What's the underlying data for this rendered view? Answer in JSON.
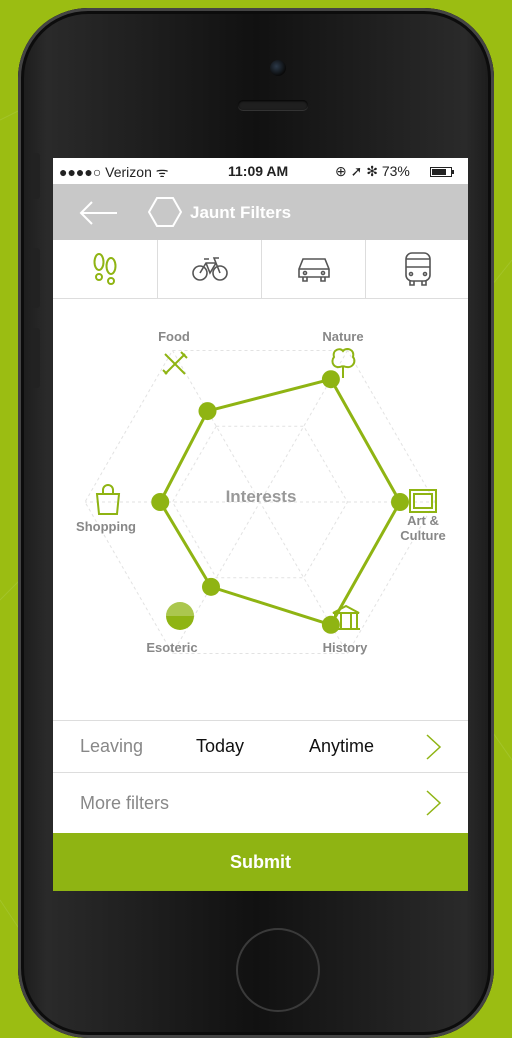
{
  "status": {
    "carrier": "●●●●○ Verizon ᯤ",
    "time": "11:09 AM",
    "right": "⊕ ➚ ✻ 73%"
  },
  "nav": {
    "title": "Jaunt Filters"
  },
  "modes": [
    "walk-icon",
    "bike-icon",
    "car-icon",
    "bus-icon"
  ],
  "radar": {
    "center_label": "Interests",
    "categories": [
      "Food",
      "Nature",
      "Art & Culture",
      "History",
      "Esoteric",
      "Shopping"
    ],
    "values": [
      0.6,
      0.81,
      0.8,
      0.81,
      0.56,
      0.57
    ]
  },
  "leaving": {
    "label": "Leaving",
    "day": "Today",
    "time": "Anytime"
  },
  "more": {
    "label": "More filters"
  },
  "submit": {
    "label": "Submit"
  },
  "colors": {
    "accent": "#8fb413",
    "background": "#9bbd12",
    "navbar": "#c8c8c8"
  }
}
